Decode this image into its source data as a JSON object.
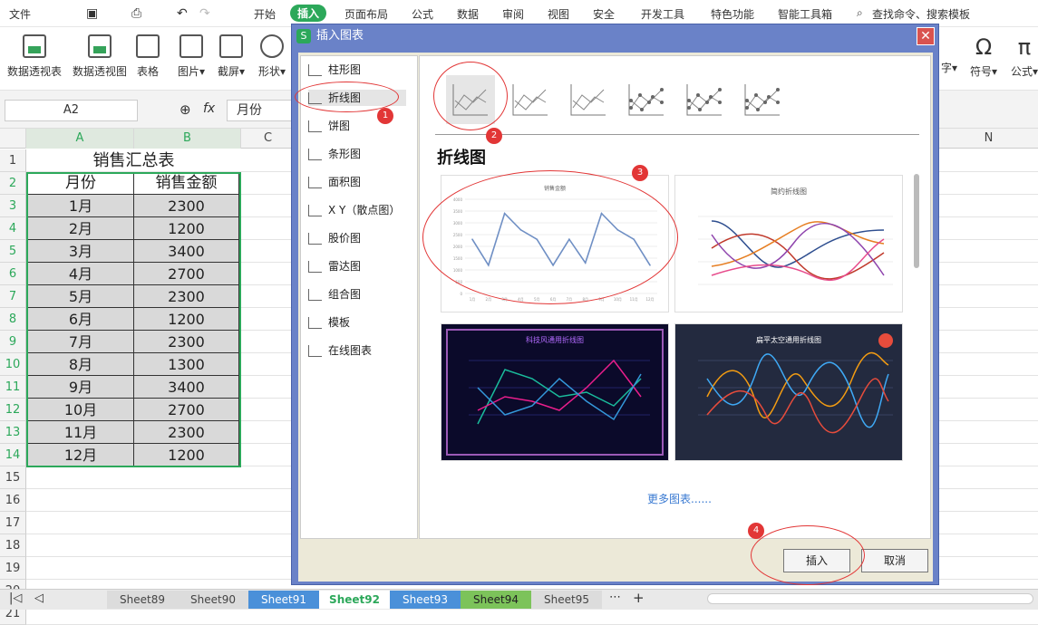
{
  "menu": {
    "file": "文件",
    "items": [
      "开始",
      "插入",
      "页面布局",
      "公式",
      "数据",
      "审阅",
      "视图",
      "安全",
      "开发工具",
      "特色功能",
      "智能工具箱"
    ],
    "search": "查找命令、搜索模板"
  },
  "ribbon": {
    "buttons": [
      "数据透视表",
      "数据透视图",
      "表格",
      "图片",
      "截屏",
      "形状",
      "字",
      "符号",
      "公式"
    ]
  },
  "formula": {
    "namebox": "A2",
    "fx": "fx",
    "value": "月份"
  },
  "grid": {
    "columns": [
      "A",
      "B",
      "C",
      "N"
    ],
    "rows": [
      "1",
      "2",
      "3",
      "4",
      "5",
      "6",
      "7",
      "8",
      "9",
      "10",
      "11",
      "12",
      "13",
      "14",
      "15",
      "16",
      "17",
      "18",
      "19",
      "20",
      "21"
    ],
    "title": "销售汇总表",
    "headers": [
      "月份",
      "销售金额"
    ],
    "data": [
      [
        "1月",
        "2300"
      ],
      [
        "2月",
        "1200"
      ],
      [
        "3月",
        "3400"
      ],
      [
        "4月",
        "2700"
      ],
      [
        "5月",
        "2300"
      ],
      [
        "6月",
        "1200"
      ],
      [
        "7月",
        "2300"
      ],
      [
        "8月",
        "1300"
      ],
      [
        "9月",
        "3400"
      ],
      [
        "10月",
        "2700"
      ],
      [
        "11月",
        "2300"
      ],
      [
        "12月",
        "1200"
      ]
    ]
  },
  "sheets": [
    "Sheet89",
    "Sheet90",
    "Sheet91",
    "Sheet92",
    "Sheet93",
    "Sheet94",
    "Sheet95"
  ],
  "dialog": {
    "title": "插入图表",
    "categories": [
      "柱形图",
      "折线图",
      "饼图",
      "条形图",
      "面积图",
      "X Y（散点图）",
      "股价图",
      "雷达图",
      "组合图",
      "模板",
      "在线图表"
    ],
    "section_title": "折线图",
    "templates": [
      "销售金额",
      "简约折线图",
      "科技风通用折线图",
      "扁平太空通用折线图"
    ],
    "more": "更多图表......",
    "insert": "插入",
    "cancel": "取消"
  },
  "annotations": [
    "1",
    "2",
    "3",
    "4"
  ],
  "chart_data": {
    "type": "line",
    "title": "销售金额",
    "categories": [
      "1月",
      "2月",
      "3月",
      "4月",
      "5月",
      "6月",
      "7月",
      "8月",
      "9月",
      "10月",
      "11月",
      "12月"
    ],
    "values": [
      2300,
      1200,
      3400,
      2700,
      2300,
      1200,
      2300,
      1300,
      3400,
      2700,
      2300,
      1200
    ]
  }
}
